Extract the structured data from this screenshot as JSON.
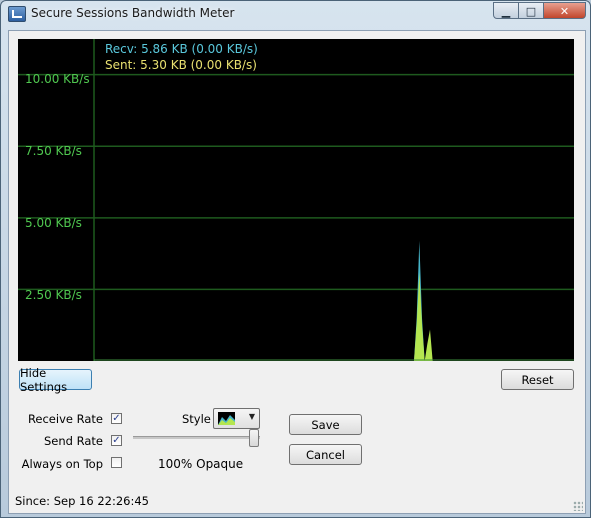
{
  "window": {
    "title": "Secure Sessions Bandwidth Meter",
    "controls": {
      "minimize": "▁",
      "maximize": "□",
      "close": "✕"
    }
  },
  "graph": {
    "recv_label": "Recv: 5.86 KB (0.00 KB/s)",
    "sent_label": "Sent: 5.30 KB (0.00 KB/s)",
    "y_ticks": [
      "10.00 KB/s",
      "7.50 KB/s",
      "5.00 KB/s",
      "2.50 KB/s"
    ],
    "colors": {
      "background": "#000000",
      "grid": "#1e5a1e",
      "recv": "#46b4c8",
      "sent": "#b4e650",
      "label_green": "#50c850"
    }
  },
  "chart_data": {
    "type": "area",
    "ylabel": "",
    "ylim": [
      0,
      11
    ],
    "y_ticks": [
      2.5,
      5.0,
      7.5,
      10.0
    ],
    "series": [
      {
        "name": "Recv",
        "x": [
          0,
          120,
          121,
          122,
          123,
          124,
          125,
          126,
          180
        ],
        "values": [
          0,
          0,
          1.5,
          4.2,
          1.5,
          0,
          0,
          0,
          0
        ]
      },
      {
        "name": "Sent",
        "x": [
          0,
          120,
          121,
          122,
          123,
          124,
          125,
          126,
          127,
          180
        ],
        "values": [
          0,
          0,
          1.3,
          3.1,
          1.3,
          0,
          0.6,
          1.1,
          0,
          0
        ]
      }
    ]
  },
  "buttons": {
    "hide_settings": "Hide Settings",
    "reset": "Reset",
    "save": "Save",
    "cancel": "Cancel"
  },
  "settings": {
    "receive_rate": {
      "label": "Receive Rate",
      "checked": true
    },
    "send_rate": {
      "label": "Send Rate",
      "checked": true
    },
    "always_on_top": {
      "label": "Always on Top",
      "checked": false
    },
    "style_label": "Style",
    "opacity_text": "100% Opaque",
    "opacity_percent": 100
  },
  "status": {
    "since": "Since: Sep 16 22:26:45"
  },
  "icons": {
    "checkmark": "✓",
    "dropdown": "▼"
  }
}
